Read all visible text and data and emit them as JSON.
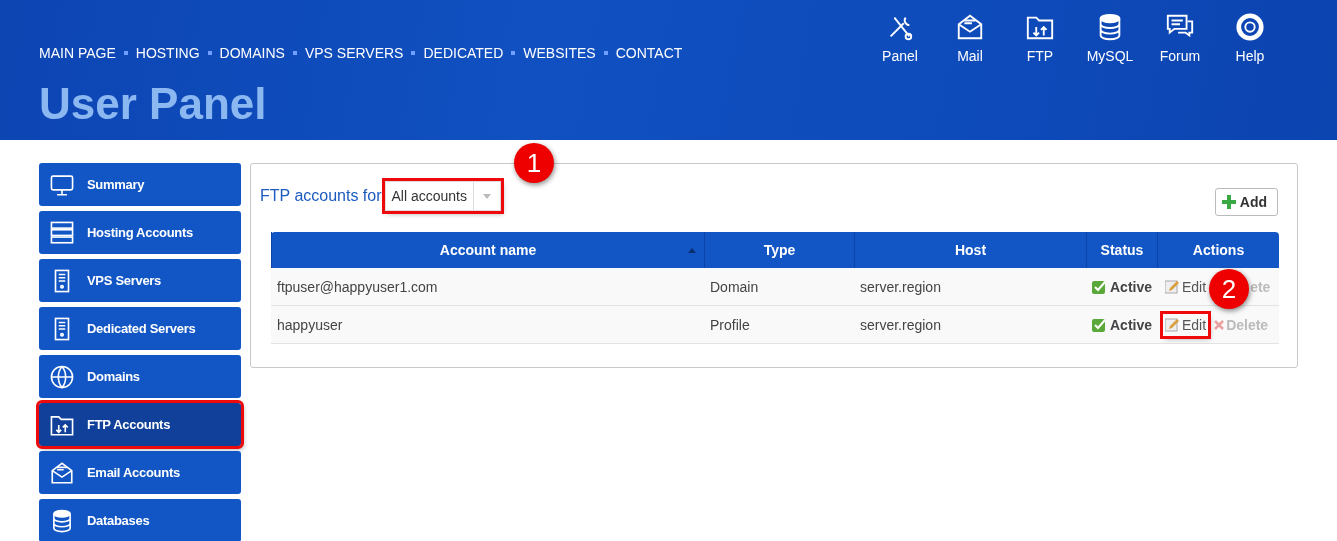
{
  "nav": [
    "MAIN PAGE",
    "HOSTING",
    "DOMAINS",
    "VPS SERVERS",
    "DEDICATED",
    "WEBSITES",
    "CONTACT"
  ],
  "tools": [
    {
      "kind": "tools",
      "label": "Panel"
    },
    {
      "kind": "mail",
      "label": "Mail"
    },
    {
      "kind": "ftp",
      "label": "FTP"
    },
    {
      "kind": "database",
      "label": "MySQL"
    },
    {
      "kind": "chat",
      "label": "Forum"
    },
    {
      "kind": "lifebuoy",
      "label": "Help"
    }
  ],
  "page_title": "User Panel",
  "sidebar": {
    "items": [
      {
        "kind": "monitor",
        "label": "Summary",
        "selected": false,
        "highlighted": false
      },
      {
        "kind": "rack",
        "label": "Hosting Accounts",
        "selected": false,
        "highlighted": false
      },
      {
        "kind": "server",
        "label": "VPS Servers",
        "selected": false,
        "highlighted": false
      },
      {
        "kind": "server",
        "label": "Dedicated Servers",
        "selected": false,
        "highlighted": false
      },
      {
        "kind": "globe",
        "label": "Domains",
        "selected": false,
        "highlighted": false
      },
      {
        "kind": "ftp",
        "label": "FTP Accounts",
        "selected": true,
        "highlighted": true
      },
      {
        "kind": "mail",
        "label": "Email Accounts",
        "selected": false,
        "highlighted": false
      },
      {
        "kind": "database",
        "label": "Databases",
        "selected": false,
        "highlighted": false
      }
    ]
  },
  "filter": {
    "label": "FTP accounts for",
    "value": "All accounts",
    "highlighted": true,
    "callout": "1"
  },
  "add_button": "Add",
  "table": {
    "columns": [
      "Account name",
      "Type",
      "Host",
      "Status",
      "Actions"
    ],
    "rows": [
      {
        "account_name": "ftpuser@happyuser1.com",
        "type": "Domain",
        "host": "server.region",
        "status": "Active",
        "edit": "Edit",
        "edit_highlighted": false,
        "delete": "ete",
        "callout": "2"
      },
      {
        "account_name": "happyuser",
        "type": "Profile",
        "host": "server.region",
        "status": "Active",
        "edit": "Edit",
        "edit_highlighted": true,
        "delete": "Delete"
      }
    ]
  }
}
